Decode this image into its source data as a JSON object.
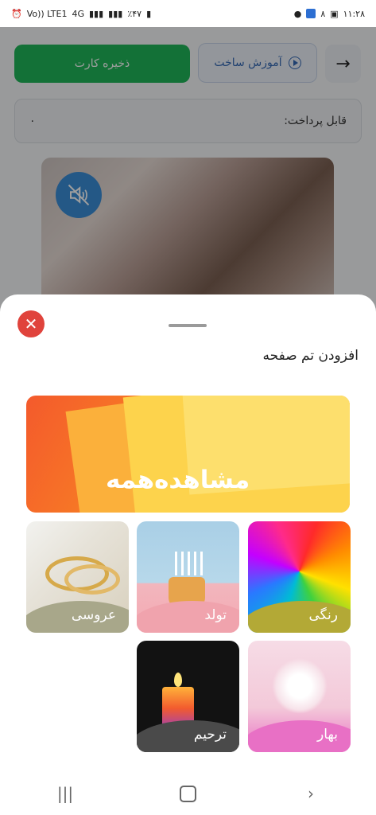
{
  "statusbar": {
    "time": "۱۱:۲۸",
    "battery": "٪۴۷",
    "network": "4G",
    "volte": "Vo)) LTE1",
    "notif_badge": "۸"
  },
  "page": {
    "save_button": "ذخیره کارت",
    "tutorial_button": "آموزش ساخت",
    "payable_label": "قابل پرداخت:",
    "payable_value": "۰"
  },
  "sheet": {
    "title": "افزودن تم صفحه",
    "banner_label": "مشاهده‌همه",
    "themes": [
      {
        "label": "رنگی"
      },
      {
        "label": "تولد"
      },
      {
        "label": "عروسی"
      },
      {
        "label": "بهار"
      },
      {
        "label": "ترحیم"
      }
    ]
  },
  "colors": {
    "save_green": "#1fb75a",
    "tutorial_blue": "#3569b5",
    "close_red": "#e0433c"
  }
}
